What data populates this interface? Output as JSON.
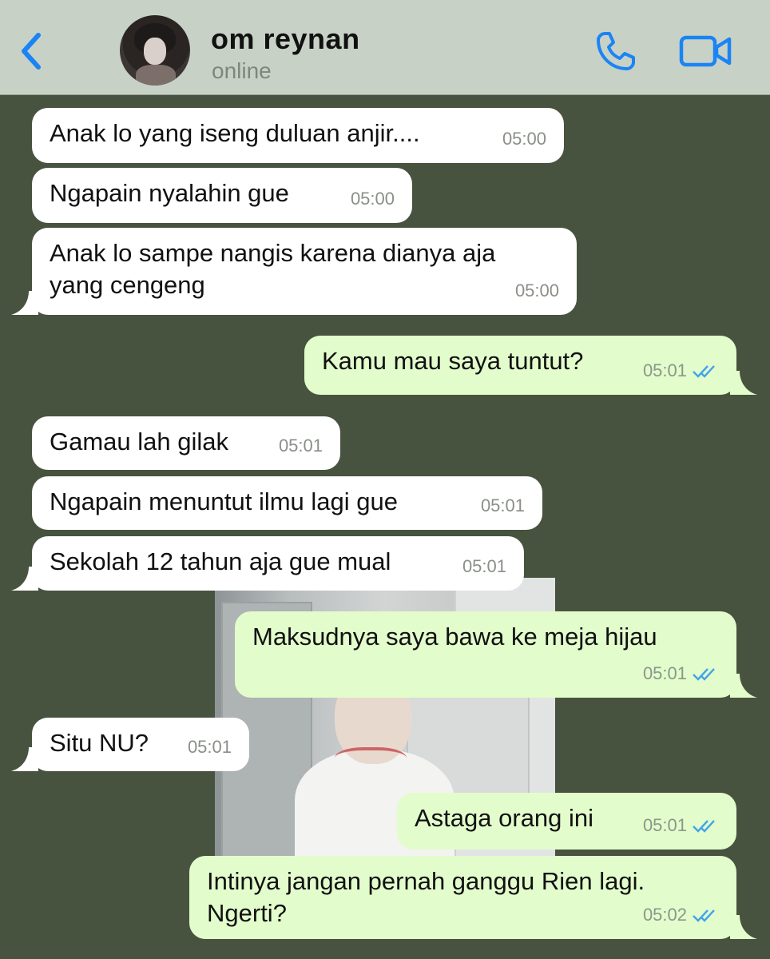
{
  "contact": {
    "name": "om reynan",
    "status": "online"
  },
  "colors": {
    "accent": "#1b84f4",
    "chat_background": "#47533e",
    "incoming_bubble": "#ffffff",
    "outgoing_bubble": "#e2fccc",
    "read_ticks": "#43a3ea"
  },
  "messages": [
    {
      "dir": "in",
      "text": "Anak lo yang iseng duluan anjir....",
      "time": "05:00"
    },
    {
      "dir": "in",
      "text": "Ngapain nyalahin gue",
      "time": "05:00"
    },
    {
      "dir": "in",
      "text": "Anak lo sampe nangis karena dianya aja\nyang cengeng",
      "time": "05:00"
    },
    {
      "dir": "out",
      "text": "Kamu mau saya tuntut?",
      "time": "05:01",
      "status": "read"
    },
    {
      "dir": "in",
      "text": "Gamau lah gilak",
      "time": "05:01"
    },
    {
      "dir": "in",
      "text": "Ngapain menuntut ilmu lagi gue",
      "time": "05:01"
    },
    {
      "dir": "in",
      "text": "Sekolah 12 tahun aja gue mual",
      "time": "05:01"
    },
    {
      "dir": "out",
      "text": "Maksudnya saya bawa ke meja hijau",
      "time": "05:01",
      "status": "read"
    },
    {
      "dir": "in",
      "text": "Situ NU?",
      "time": "05:01"
    },
    {
      "dir": "out",
      "text": "Astaga orang ini",
      "time": "05:01",
      "status": "read"
    },
    {
      "dir": "out",
      "text": "Intinya jangan pernah ganggu Rien lagi.\nNgerti?",
      "time": "05:02",
      "status": "read"
    }
  ]
}
